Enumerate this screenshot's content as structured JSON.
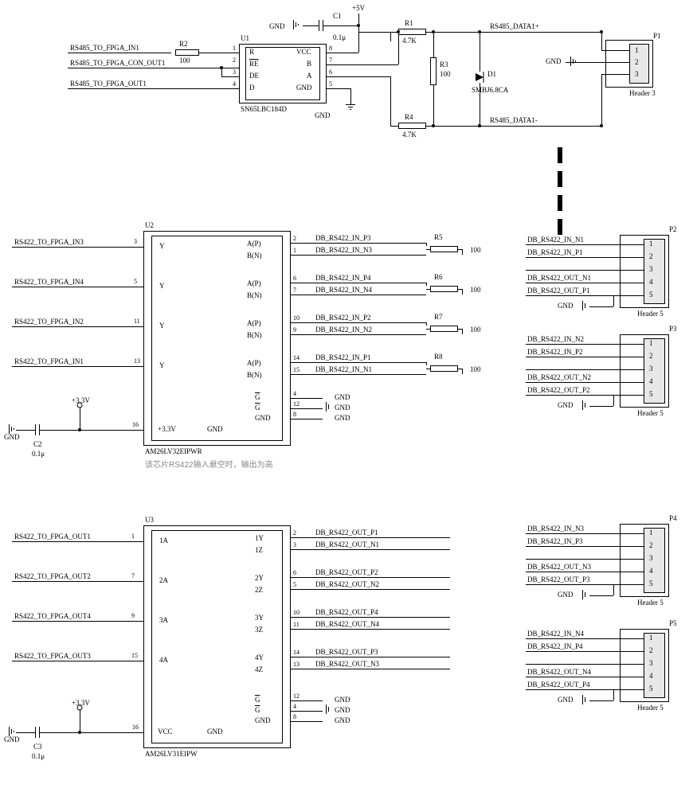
{
  "top": {
    "u1": {
      "ref": "U1",
      "part": "SN65LBC184D",
      "pins_left": [
        {
          "num": "1",
          "name": "R"
        },
        {
          "num": "2",
          "name": "RE",
          "bar": true
        },
        {
          "num": "3",
          "name": "DE"
        },
        {
          "num": "4",
          "name": "D"
        }
      ],
      "pins_right": [
        {
          "num": "8",
          "name": "VCC"
        },
        {
          "num": "7",
          "name": "B"
        },
        {
          "num": "6",
          "name": "A"
        },
        {
          "num": "5",
          "name": "GND"
        }
      ]
    },
    "nets_left": [
      "RS485_TO_FPGA_IN1",
      "RS485_TO_FPGA_CON_OUT1",
      "RS485_TO_FPGA_OUT1"
    ],
    "r2": {
      "ref": "R2",
      "val": "100"
    },
    "c1": {
      "ref": "C1",
      "val": "0.1μ"
    },
    "v5": "+5V",
    "gnd": "GND",
    "r1": {
      "ref": "R1",
      "val": "4.7K"
    },
    "r3": {
      "ref": "R3",
      "val": "100"
    },
    "r4": {
      "ref": "R4",
      "val": "4.7K"
    },
    "d1": {
      "ref": "D1",
      "part": "SMBJ6.8CA"
    },
    "nets_right": [
      "RS485_DATA1+",
      "RS485_DATA1-"
    ],
    "p1": {
      "ref": "P1",
      "part": "Header 3",
      "pins": [
        "1",
        "2",
        "3"
      ]
    }
  },
  "u2": {
    "ref": "U2",
    "part": "AM26LV32EIPWR",
    "note": "该芯片RS422输入悬空时，输出为高",
    "left_nets": [
      {
        "pin": "3",
        "net": "RS422_TO_FPGA_IN3"
      },
      {
        "pin": "5",
        "net": "RS422_TO_FPGA_IN4"
      },
      {
        "pin": "11",
        "net": "RS422_TO_FPGA_IN2"
      },
      {
        "pin": "13",
        "net": "RS422_TO_FPGA_IN1"
      }
    ],
    "left_pin_labels": [
      "Y",
      "Y",
      "Y",
      "Y"
    ],
    "right_groups": [
      {
        "ap": "2",
        "bn": "1",
        "net_p": "DB_RS422_IN_P3",
        "net_n": "DB_RS422_IN_N3",
        "r": {
          "ref": "R5",
          "val": "100"
        }
      },
      {
        "ap": "6",
        "bn": "7",
        "net_p": "DB_RS422_IN_P4",
        "net_n": "DB_RS422_IN_N4",
        "r": {
          "ref": "R6",
          "val": "100"
        }
      },
      {
        "ap": "10",
        "bn": "9",
        "net_p": "DB_RS422_IN_P2",
        "net_n": "DB_RS422_IN_N2",
        "r": {
          "ref": "R7",
          "val": "100"
        }
      },
      {
        "ap": "14",
        "bn": "15",
        "net_p": "DB_RS422_IN_P1",
        "net_n": "DB_RS422_IN_N1",
        "r": {
          "ref": "R8",
          "val": "100"
        }
      }
    ],
    "right_pin_labels": [
      [
        "A(P)",
        "B(N)"
      ],
      [
        "A(P)",
        "B(N)"
      ],
      [
        "A(P)",
        "B(N)"
      ],
      [
        "A(P)",
        "B(N)"
      ]
    ],
    "g_pins": [
      "4",
      "12",
      "8"
    ],
    "g_labels": [
      "G",
      "G",
      "GND"
    ],
    "g_bar": [
      true,
      true,
      false
    ],
    "g_nets": [
      "GND",
      "GND",
      "GND"
    ],
    "vcc_pin": "16",
    "vcc_label": "+3.3V",
    "c2": {
      "ref": "C2",
      "val": "0.1μ"
    },
    "v33": "+3.3V"
  },
  "u3": {
    "ref": "U3",
    "part": "AM26LV31EIPW",
    "left_nets": [
      {
        "pin": "1",
        "net": "RS422_TO_FPGA_OUT1",
        "lbl": "1A"
      },
      {
        "pin": "7",
        "net": "RS422_TO_FPGA_OUT2",
        "lbl": "2A"
      },
      {
        "pin": "9",
        "net": "RS422_TO_FPGA_OUT4",
        "lbl": "3A"
      },
      {
        "pin": "15",
        "net": "RS422_TO_FPGA_OUT3",
        "lbl": "4A"
      }
    ],
    "right_groups": [
      {
        "y": "2",
        "z": "3",
        "ylbl": "1Y",
        "zlbl": "1Z",
        "net_y": "DB_RS422_OUT_P1",
        "net_z": "DB_RS422_OUT_N1"
      },
      {
        "y": "6",
        "z": "5",
        "ylbl": "2Y",
        "zlbl": "2Z",
        "net_y": "DB_RS422_OUT_P2",
        "net_z": "DB_RS422_OUT_N2"
      },
      {
        "y": "10",
        "z": "11",
        "ylbl": "3Y",
        "zlbl": "3Z",
        "net_y": "DB_RS422_OUT_P4",
        "net_z": "DB_RS422_OUT_N4"
      },
      {
        "y": "14",
        "z": "13",
        "ylbl": "4Y",
        "zlbl": "4Z",
        "net_y": "DB_RS422_OUT_P3",
        "net_z": "DB_RS422_OUT_N3"
      }
    ],
    "g_pins": [
      "12",
      "4",
      "8"
    ],
    "g_labels": [
      "G",
      "G",
      "GND"
    ],
    "g_bar": [
      true,
      true,
      false
    ],
    "g_nets": [
      "GND",
      "GND",
      "GND"
    ],
    "vcc_pin": "16",
    "vcc_label": "VCC",
    "c3": {
      "ref": "C3",
      "val": "0.1μ"
    },
    "v33": "+3.3V"
  },
  "headers": {
    "p2": {
      "ref": "P2",
      "part": "Header 5",
      "pins": [
        "1",
        "2",
        "3",
        "4",
        "5"
      ],
      "nets": [
        "DB_RS422_IN_N1",
        "DB_RS422_IN_P1",
        "",
        "DB_RS422_OUT_N1",
        "DB_RS422_OUT_P1"
      ],
      "gnd": "GND"
    },
    "p3": {
      "ref": "P3",
      "part": "Header 5",
      "pins": [
        "1",
        "2",
        "3",
        "4",
        "5"
      ],
      "nets": [
        "DB_RS422_IN_N2",
        "DB_RS422_IN_P2",
        "",
        "DB_RS422_OUT_N2",
        "DB_RS422_OUT_P2"
      ],
      "gnd": "GND"
    },
    "p4": {
      "ref": "P4",
      "part": "Header 5",
      "pins": [
        "1",
        "2",
        "3",
        "4",
        "5"
      ],
      "nets": [
        "DB_RS422_IN_N3",
        "DB_RS422_IN_P3",
        "",
        "DB_RS422_OUT_N3",
        "DB_RS422_OUT_P3"
      ],
      "gnd": "GND"
    },
    "p5": {
      "ref": "P5",
      "part": "Header 5",
      "pins": [
        "1",
        "2",
        "3",
        "4",
        "5"
      ],
      "nets": [
        "DB_RS422_IN_N4",
        "DB_RS422_IN_P4",
        "",
        "DB_RS422_OUT_N4",
        "DB_RS422_OUT_P4"
      ],
      "gnd": "GND"
    }
  }
}
